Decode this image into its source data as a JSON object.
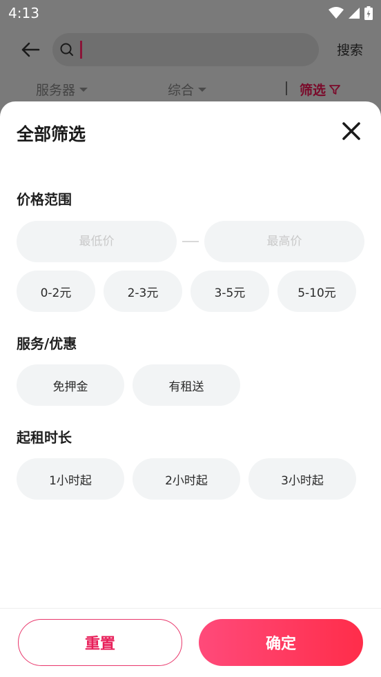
{
  "status_bar": {
    "time": "4:13"
  },
  "search": {
    "placeholder": "",
    "button_label": "搜索"
  },
  "filter_bar": {
    "items": [
      {
        "label": "服务器"
      },
      {
        "label": "综合"
      }
    ],
    "active": {
      "label": "筛选"
    }
  },
  "sheet": {
    "title": "全部筛选",
    "price": {
      "title": "价格范围",
      "min_placeholder": "最低价",
      "max_placeholder": "最高价",
      "options": [
        "0-2元",
        "2-3元",
        "3-5元",
        "5-10元"
      ]
    },
    "service": {
      "title": "服务/优惠",
      "options": [
        "免押金",
        "有租送"
      ]
    },
    "duration": {
      "title": "起租时长",
      "options": [
        "1小时起",
        "2小时起",
        "3小时起"
      ]
    },
    "actions": {
      "reset": "重置",
      "confirm": "确定"
    }
  },
  "colors": {
    "accent": "#ff2d55",
    "chip_bg": "#f2f4f5",
    "overlay": "#7a7a7a"
  }
}
